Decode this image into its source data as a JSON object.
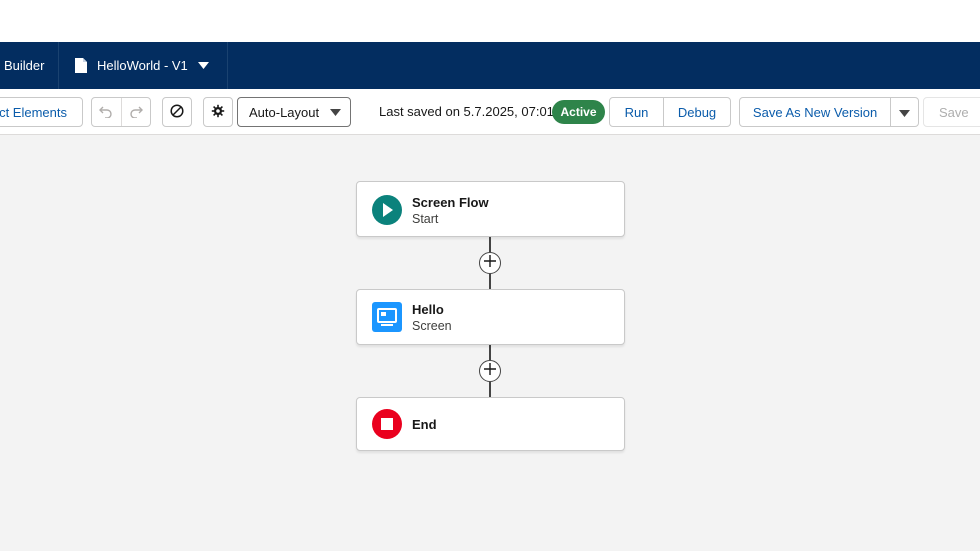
{
  "nav": {
    "app_name": "Builder",
    "tab_label": "HelloWorld - V1"
  },
  "toolbar": {
    "select_elements_label": "ct Elements",
    "layout_select_value": "Auto-Layout",
    "last_saved_text": "Last saved on 5.7.2025, 07:01",
    "status_badge": "Active",
    "run_label": "Run",
    "debug_label": "Debug",
    "save_as_new_label": "Save As New Version",
    "save_label": "Save"
  },
  "canvas": {
    "nodes": [
      {
        "title": "Screen Flow",
        "subtitle": "Start",
        "icon": "play-icon",
        "icon_color": "#0b827c"
      },
      {
        "title": "Hello",
        "subtitle": "Screen",
        "icon": "screen-icon",
        "icon_color": "#1b96ff"
      },
      {
        "title": "End",
        "subtitle": "",
        "icon": "stop-icon",
        "icon_color": "#ea001e"
      }
    ]
  },
  "colors": {
    "nav_bg": "#032d60",
    "brand_blue": "#0b5cab",
    "active_green": "#2e844a",
    "canvas_bg": "#f3f3f3"
  }
}
